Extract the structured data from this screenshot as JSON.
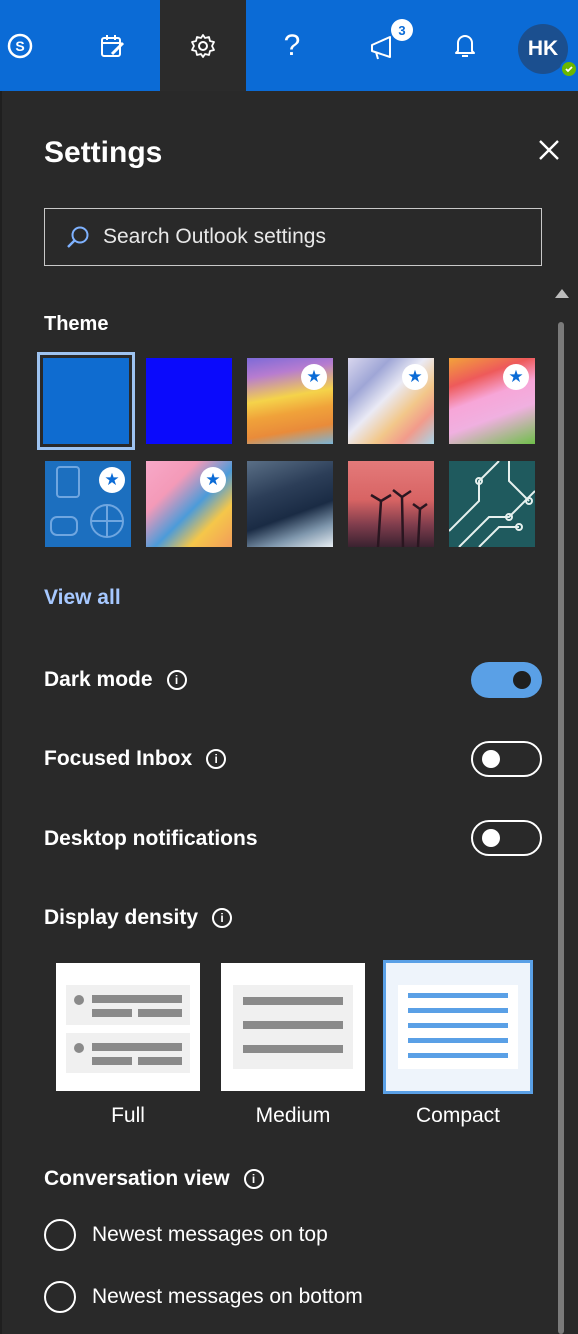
{
  "topbar": {
    "icons": [
      "skype-icon",
      "my-day-icon",
      "settings-gear-icon",
      "help-icon",
      "whats-new-megaphone-icon",
      "notifications-bell-icon"
    ],
    "whats_new_badge": "3",
    "avatar_initials": "HK",
    "presence": "available",
    "bar_color": "#0b6bd6",
    "active_tab_color": "#2b2b2b"
  },
  "settings": {
    "title": "Settings",
    "search_placeholder": "Search Outlook settings",
    "theme": {
      "title": "Theme",
      "view_all": "View all",
      "items": [
        {
          "name": "blue",
          "selected": true
        },
        {
          "name": "royal-blue",
          "selected": false
        },
        {
          "name": "yellow-waves",
          "premium": true
        },
        {
          "name": "silk-ribbons",
          "premium": true
        },
        {
          "name": "fiery-creature",
          "premium": true
        },
        {
          "name": "school-supplies",
          "premium": true
        },
        {
          "name": "board-game",
          "premium": true
        },
        {
          "name": "ocean-wave",
          "premium": false
        },
        {
          "name": "palm-sunset",
          "premium": false
        },
        {
          "name": "circuit-board",
          "premium": false
        }
      ]
    },
    "dark_mode": {
      "label": "Dark mode",
      "on": true
    },
    "focused_inbox": {
      "label": "Focused Inbox",
      "on": false
    },
    "desktop_notifications": {
      "label": "Desktop notifications",
      "on": false
    },
    "display_density": {
      "title": "Display density",
      "options": [
        {
          "label": "Full",
          "selected": false
        },
        {
          "label": "Medium",
          "selected": false
        },
        {
          "label": "Compact",
          "selected": true
        }
      ]
    },
    "conversation_view": {
      "title": "Conversation view",
      "options": [
        {
          "label": "Newest messages on top",
          "selected": false
        },
        {
          "label": "Newest messages on bottom",
          "selected": false
        }
      ]
    },
    "colors": {
      "panel_bg": "#292929",
      "accent": "#5aa0e6",
      "link": "#a6c8ff"
    }
  }
}
